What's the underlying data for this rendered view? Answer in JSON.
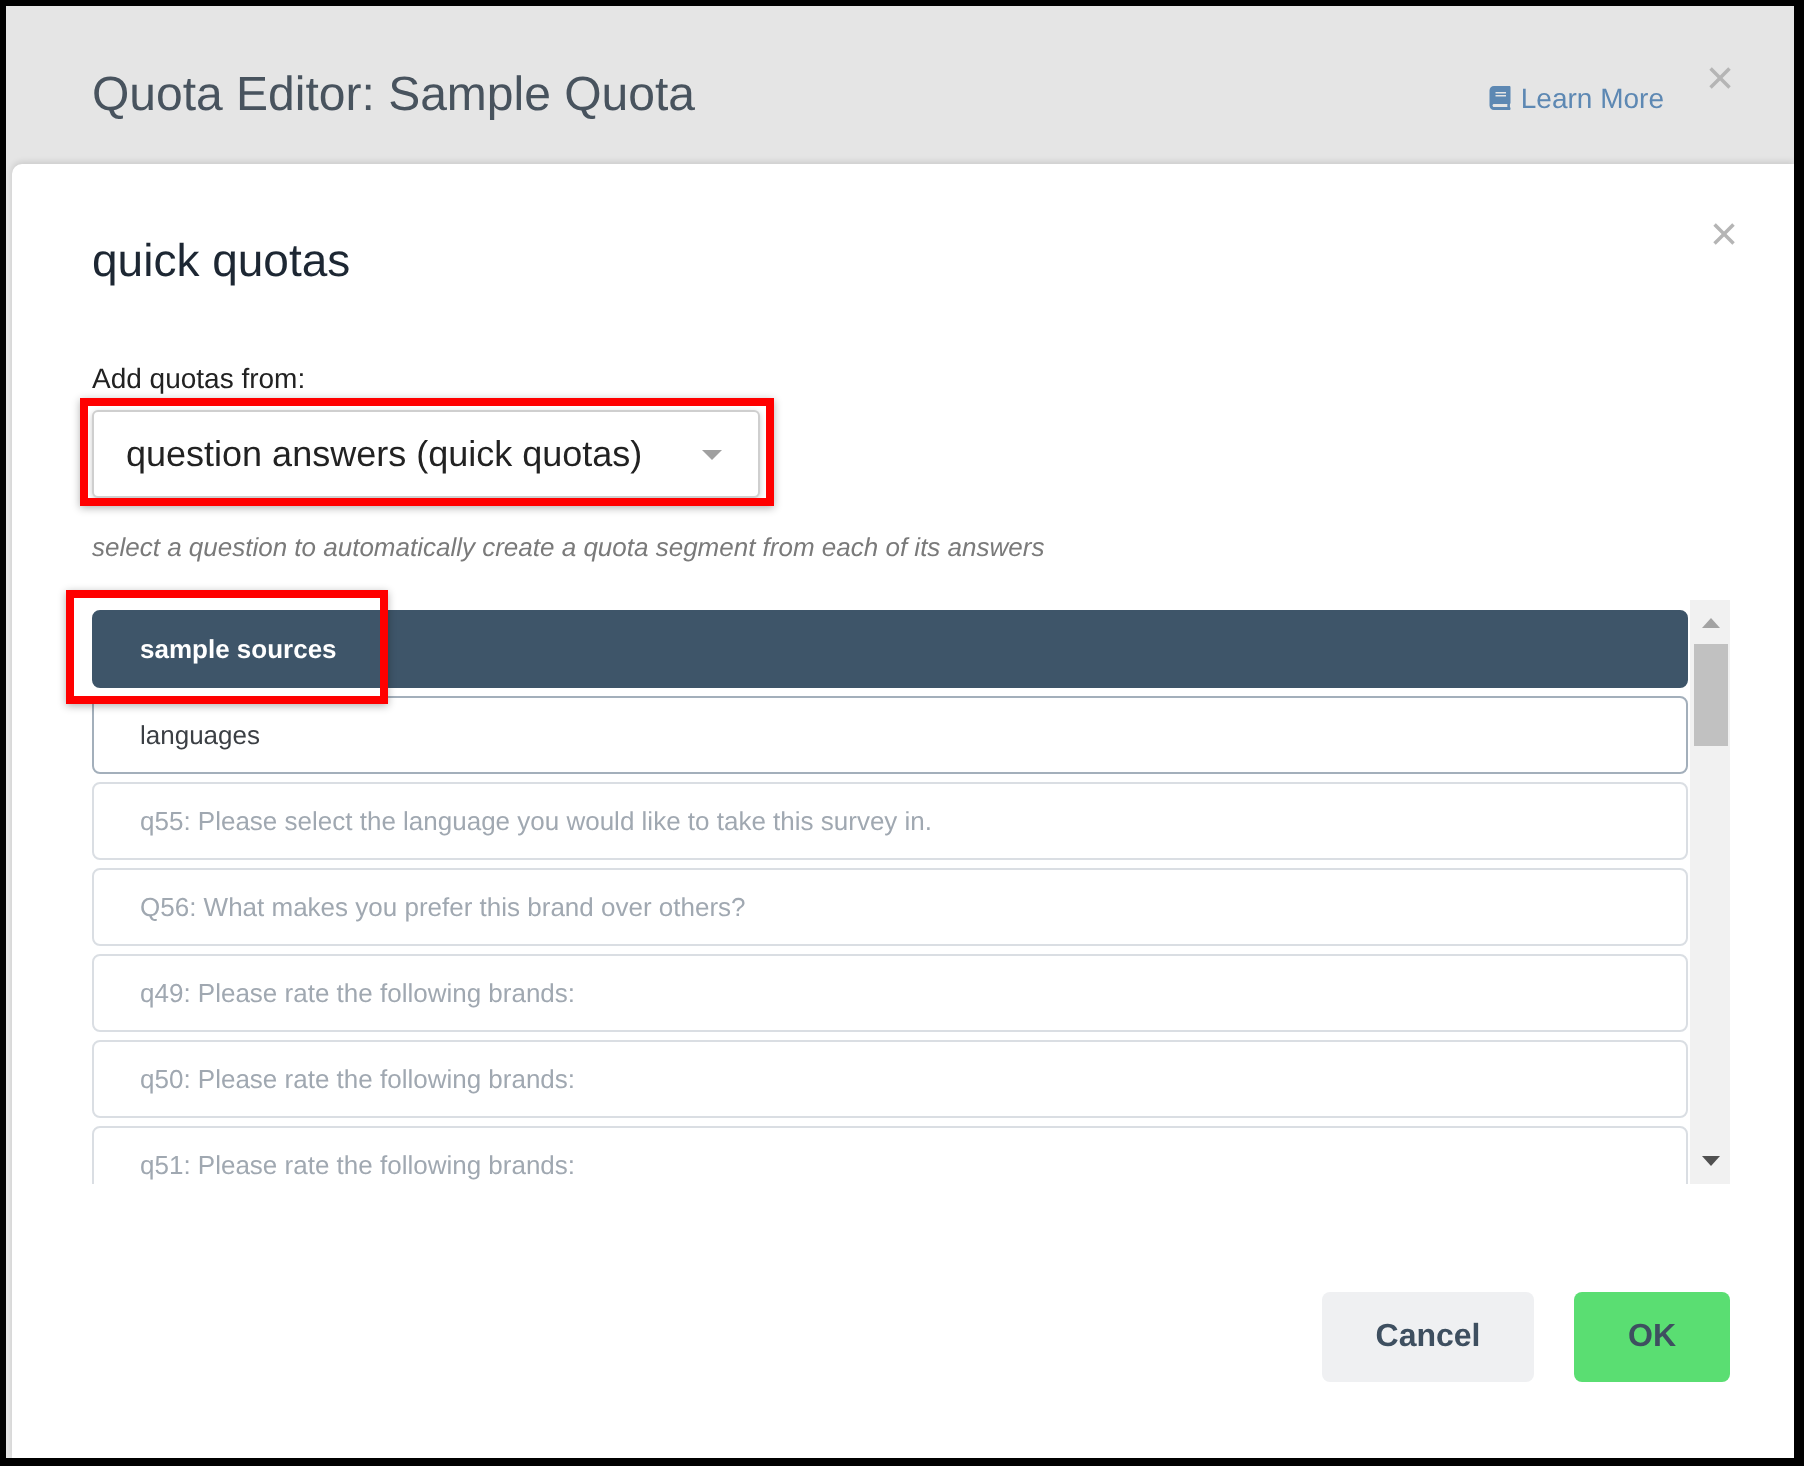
{
  "dialog": {
    "title": "Quota Editor: Sample Quota",
    "learn_more": "Learn More",
    "close": "×"
  },
  "panel": {
    "title": "quick quotas",
    "close": "×",
    "source_label": "Add quotas from:",
    "source_select": {
      "value": "question answers (quick quotas)",
      "highlighted": true
    },
    "hint": "select a question to automatically create a quota segment from each of its answers",
    "questions": [
      {
        "label": "sample sources",
        "selected": true,
        "disabled": false,
        "highlighted": true
      },
      {
        "label": "languages",
        "selected": false,
        "disabled": false,
        "highlighted": false
      },
      {
        "label": "q55: Please select the language you would like to take this survey in.",
        "selected": false,
        "disabled": true,
        "highlighted": false
      },
      {
        "label": "Q56: What makes you prefer this brand over others?",
        "selected": false,
        "disabled": true,
        "highlighted": false
      },
      {
        "label": "q49: Please rate the following brands:",
        "selected": false,
        "disabled": true,
        "highlighted": false
      },
      {
        "label": "q50: Please rate the following brands:",
        "selected": false,
        "disabled": true,
        "highlighted": false
      },
      {
        "label": "q51: Please rate the following brands:",
        "selected": false,
        "disabled": true,
        "highlighted": false
      }
    ]
  },
  "buttons": [
    {
      "label": "Cancel",
      "kind": "secondary"
    },
    {
      "label": "OK",
      "kind": "primary"
    }
  ]
}
